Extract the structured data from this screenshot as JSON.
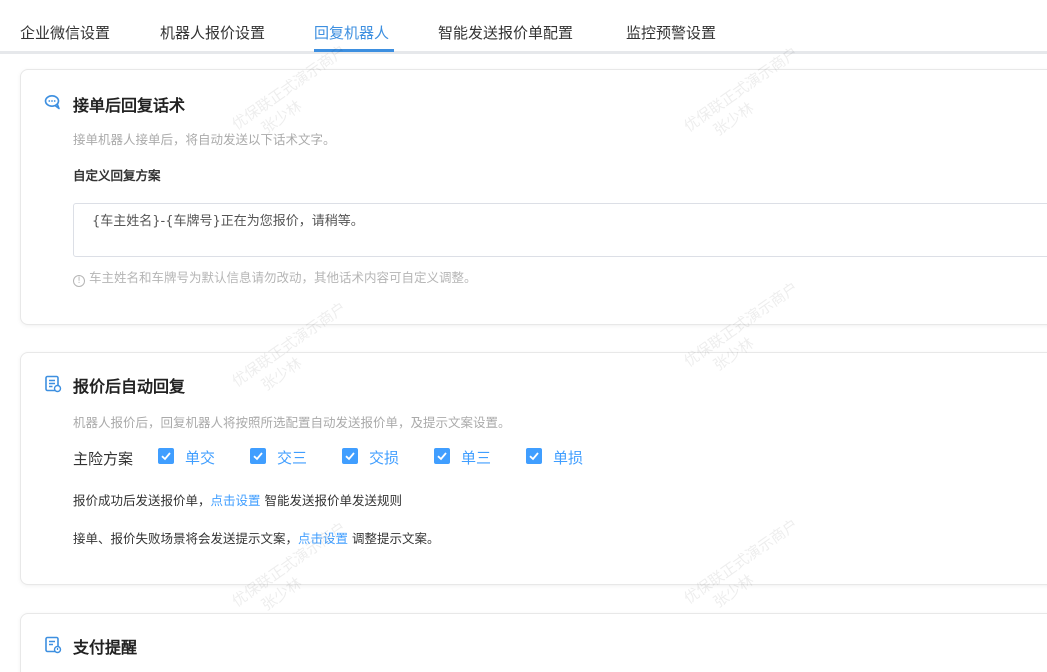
{
  "tabs": [
    {
      "label": "企业微信设置",
      "active": false
    },
    {
      "label": "机器人报价设置",
      "active": false
    },
    {
      "label": "回复机器人",
      "active": true
    },
    {
      "label": "智能发送报价单配置",
      "active": false
    },
    {
      "label": "监控预警设置",
      "active": false
    }
  ],
  "section1": {
    "title": "接单后回复话术",
    "desc": "接单机器人接单后，将自动发送以下话术文字。",
    "custom_label": "自定义回复方案",
    "textarea_value": "{车主姓名}-{车牌号}正在为您报价，请稍等。",
    "hint": "车主姓名和车牌号为默认信息请勿改动，其他话术内容可自定义调整。"
  },
  "section2": {
    "title": "报价后自动回复",
    "desc": "机器人报价后，回复机器人将按照所选配置自动发送报价单，及提示文案设置。",
    "plan_label": "主险方案",
    "plans": [
      {
        "label": "单交",
        "checked": true
      },
      {
        "label": "交三",
        "checked": true
      },
      {
        "label": "交损",
        "checked": true
      },
      {
        "label": "单三",
        "checked": true
      },
      {
        "label": "单损",
        "checked": true
      }
    ],
    "line1_prefix": "报价成功后发送报价单，",
    "line1_link": "点击设置",
    "line1_suffix": " 智能发送报价单发送规则",
    "line2_prefix": "接单、报价失败场景将会发送提示文案，",
    "line2_link": "点击设置",
    "line2_suffix": " 调整提示文案。"
  },
  "section3": {
    "title": "支付提醒"
  },
  "watermark": {
    "line1": "优保联正式演示商户",
    "line2": "张少林"
  },
  "colors": {
    "accent": "#409eff",
    "tab_active": "#3d8fe0"
  }
}
